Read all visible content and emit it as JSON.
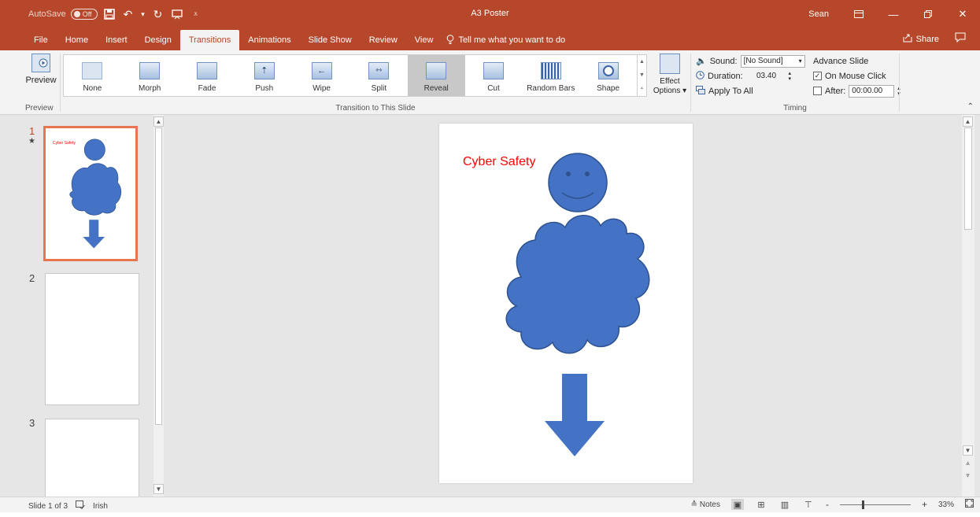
{
  "window": {
    "autosave_label": "AutoSave",
    "autosave_state": "Off",
    "title": "A3 Poster",
    "user": "Sean"
  },
  "tabs": [
    {
      "label": "File"
    },
    {
      "label": "Home"
    },
    {
      "label": "Insert"
    },
    {
      "label": "Design"
    },
    {
      "label": "Transitions"
    },
    {
      "label": "Animations"
    },
    {
      "label": "Slide Show"
    },
    {
      "label": "Review"
    },
    {
      "label": "View"
    }
  ],
  "active_tab": "Transitions",
  "tell_me": "Tell me what you want to do",
  "share_label": "Share",
  "ribbon": {
    "preview": {
      "button": "Preview",
      "group": "Preview"
    },
    "transitions_group": "Transition to This Slide",
    "transitions": [
      {
        "label": "None"
      },
      {
        "label": "Morph"
      },
      {
        "label": "Fade"
      },
      {
        "label": "Push"
      },
      {
        "label": "Wipe"
      },
      {
        "label": "Split"
      },
      {
        "label": "Reveal"
      },
      {
        "label": "Cut"
      },
      {
        "label": "Random Bars"
      },
      {
        "label": "Shape"
      }
    ],
    "selected_transition": "Reveal",
    "effect_options_line1": "Effect",
    "effect_options_line2": "Options",
    "timing": {
      "group": "Timing",
      "sound_label": "Sound:",
      "sound_value": "[No Sound]",
      "duration_label": "Duration:",
      "duration_value": "03.40",
      "apply_all": "Apply To All",
      "advance_title": "Advance Slide",
      "on_mouse_click": "On Mouse Click",
      "on_mouse_click_checked": true,
      "after_label": "After:",
      "after_value": "00:00.00",
      "after_checked": false
    }
  },
  "slides": [
    {
      "number": "1",
      "thumb_title": "Cyber Safety"
    },
    {
      "number": "2"
    },
    {
      "number": "3"
    }
  ],
  "current_slide": {
    "title": "Cyber Safety",
    "title_color": "#ff0000",
    "shape_color": "#4472c4"
  },
  "status": {
    "slide_indicator": "Slide 1 of 3",
    "language": "Irish",
    "notes": "Notes",
    "zoom_minus": "-",
    "zoom_plus": "+",
    "zoom": "33%"
  },
  "colors": {
    "accent": "#b7472a",
    "thumb_selected_border": "#e97550"
  }
}
